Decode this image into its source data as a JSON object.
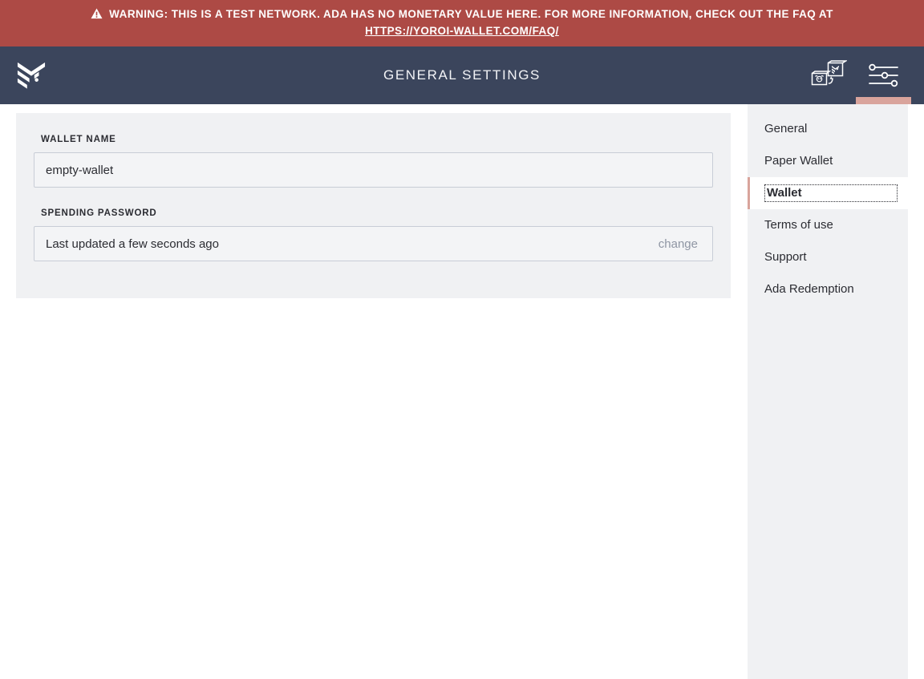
{
  "banner": {
    "icon": "warning-triangle-icon",
    "text_before_link": "WARNING: THIS IS A TEST NETWORK. ADA HAS NO MONETARY VALUE HERE. FOR MORE INFORMATION, CHECK OUT THE FAQ AT ",
    "link_text": "HTTPS://YOROI-WALLET.COM/FAQ/",
    "background_color": "#ad4a45",
    "text_color": "#ffffff"
  },
  "header": {
    "logo_icon": "yoroi-chevron-logo-icon",
    "title": "GENERAL SETTINGS",
    "background_color": "#3b455c",
    "actions": [
      {
        "name": "wallet-switch-icon",
        "label": "Switch wallet",
        "active": false
      },
      {
        "name": "settings-sliders-icon",
        "label": "Settings",
        "active": true
      }
    ],
    "active_indicator_color": "#d9a49c"
  },
  "settings": {
    "wallet_name": {
      "label": "WALLET NAME",
      "value": "empty-wallet",
      "placeholder": "Wallet name"
    },
    "spending_password": {
      "label": "SPENDING PASSWORD",
      "status": "Last updated a few seconds ago",
      "change_label": "change"
    }
  },
  "menu": {
    "items": [
      {
        "label": "General",
        "active": false
      },
      {
        "label": "Paper Wallet",
        "active": false
      },
      {
        "label": "Wallet",
        "active": true
      },
      {
        "label": "Terms of use",
        "active": false
      },
      {
        "label": "Support",
        "active": false
      },
      {
        "label": "Ada Redemption",
        "active": false
      }
    ],
    "active_accent_color": "#d9a49c"
  }
}
